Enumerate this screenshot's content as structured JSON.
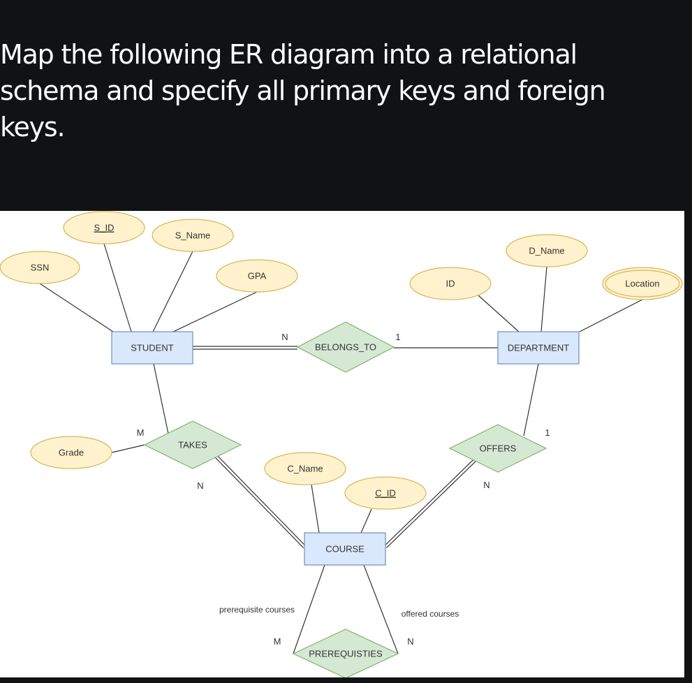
{
  "question": {
    "text": "Map the following ER diagram into a relational schema and specify all primary keys and foreign keys."
  },
  "colors": {
    "background": "#111214",
    "canvas": "#ffffff",
    "entity_fill": "#dae8fc",
    "entity_stroke": "#6c8ebf",
    "attribute_fill": "#fff2cc",
    "attribute_stroke": "#d6b656",
    "relationship_fill": "#d5e8d4",
    "relationship_stroke": "#82b366",
    "line": "#333333"
  },
  "diagram": {
    "entities": [
      {
        "id": "student",
        "label": "STUDENT"
      },
      {
        "id": "department",
        "label": "DEPARTMENT"
      },
      {
        "id": "course",
        "label": "COURSE"
      }
    ],
    "relationships": [
      {
        "id": "belongs_to",
        "label": "BELONGS_TO"
      },
      {
        "id": "takes",
        "label": "TAKES"
      },
      {
        "id": "offers",
        "label": "OFFERS"
      },
      {
        "id": "prerequisties",
        "label": "PREREQUISTIES"
      }
    ],
    "attributes": [
      {
        "id": "s_id",
        "label": "S_ID",
        "owner": "student",
        "key": true,
        "multivalued": false
      },
      {
        "id": "ssn",
        "label": "SSN",
        "owner": "student",
        "key": false,
        "multivalued": false
      },
      {
        "id": "s_name",
        "label": "S_Name",
        "owner": "student",
        "key": false,
        "multivalued": false
      },
      {
        "id": "gpa",
        "label": "GPA",
        "owner": "student",
        "key": false,
        "multivalued": false
      },
      {
        "id": "d_id",
        "label": "ID",
        "owner": "department",
        "key": false,
        "multivalued": false
      },
      {
        "id": "d_name",
        "label": "D_Name",
        "owner": "department",
        "key": false,
        "multivalued": false
      },
      {
        "id": "location",
        "label": "Location",
        "owner": "department",
        "key": false,
        "multivalued": true
      },
      {
        "id": "grade",
        "label": "Grade",
        "owner": "takes",
        "key": false,
        "multivalued": false
      },
      {
        "id": "c_name",
        "label": "C_Name",
        "owner": "course",
        "key": false,
        "multivalued": false
      },
      {
        "id": "c_id",
        "label": "C_ID",
        "owner": "course",
        "key": true,
        "multivalued": false
      }
    ],
    "connections": [
      {
        "from": "student",
        "to": "belongs_to",
        "cardinality": "N",
        "total": true
      },
      {
        "from": "belongs_to",
        "to": "department",
        "cardinality": "1",
        "total": false
      },
      {
        "from": "student",
        "to": "takes",
        "cardinality": "M",
        "total": false
      },
      {
        "from": "takes",
        "to": "course",
        "cardinality": "N",
        "total": true
      },
      {
        "from": "department",
        "to": "offers",
        "cardinality": "1",
        "total": false
      },
      {
        "from": "offers",
        "to": "course",
        "cardinality": "N",
        "total": true
      },
      {
        "from": "course",
        "to": "prerequisties",
        "cardinality": "M",
        "role": "prerequisite courses",
        "total": false
      },
      {
        "from": "course",
        "to": "prerequisties",
        "cardinality": "N",
        "role": "offered courses",
        "total": false
      }
    ],
    "labels": {
      "belongs_to_student_card": "N",
      "belongs_to_department_card": "1",
      "takes_student_card": "M",
      "takes_course_card": "N",
      "offers_department_card": "1",
      "offers_course_card": "N",
      "prereq_left_card": "M",
      "prereq_right_card": "N",
      "prereq_left_role": "prerequisite courses",
      "prereq_right_role": "offered courses"
    }
  }
}
